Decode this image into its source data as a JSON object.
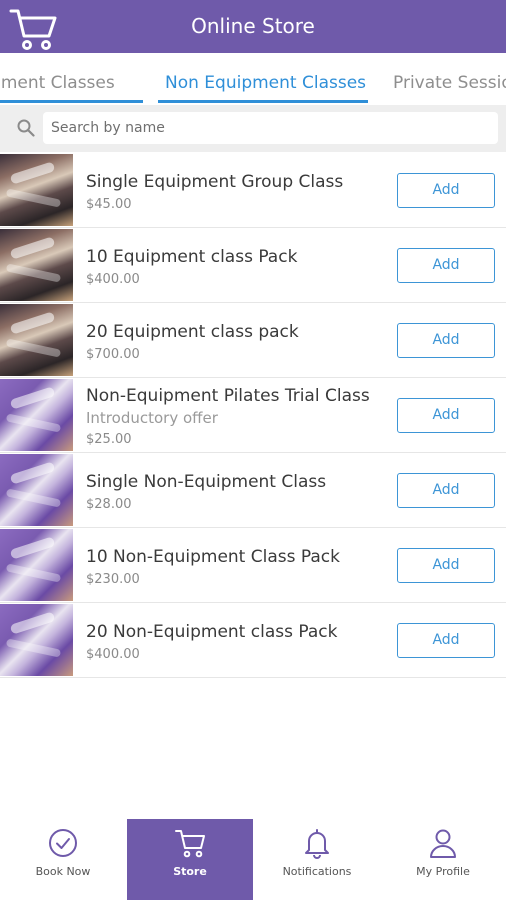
{
  "header": {
    "title": "Online Store",
    "cart_icon": "cart-icon"
  },
  "tabs": [
    {
      "label": "Equipment Classes",
      "active": false
    },
    {
      "label": "Non Equipment Classes",
      "active": true
    },
    {
      "label": "Private Sessions",
      "active": false
    }
  ],
  "search": {
    "placeholder": "Search by name",
    "icon": "search-icon"
  },
  "products": [
    {
      "name": "Single Equipment Group Class",
      "subtitle": "",
      "price": "$45.00",
      "thumb": "equipment",
      "button": "Add"
    },
    {
      "name": "10 Equipment class Pack",
      "subtitle": "",
      "price": "$400.00",
      "thumb": "equipment",
      "button": "Add"
    },
    {
      "name": "20 Equipment class pack",
      "subtitle": "",
      "price": "$700.00",
      "thumb": "equipment",
      "button": "Add"
    },
    {
      "name": "Non-Equipment Pilates Trial Class",
      "subtitle": "Introductory offer",
      "price": "$25.00",
      "thumb": "non-equipment",
      "button": "Add"
    },
    {
      "name": "Single Non-Equipment Class",
      "subtitle": "",
      "price": "$28.00",
      "thumb": "non-equipment",
      "button": "Add"
    },
    {
      "name": "10 Non-Equipment Class Pack",
      "subtitle": "",
      "price": "$230.00",
      "thumb": "non-equipment",
      "button": "Add"
    },
    {
      "name": "20 Non-Equipment class Pack",
      "subtitle": "",
      "price": "$400.00",
      "thumb": "non-equipment",
      "button": "Add"
    }
  ],
  "bottom_nav": [
    {
      "label": "Book Now",
      "icon": "check-circle-icon",
      "active": false
    },
    {
      "label": "Store",
      "icon": "cart-icon",
      "active": true
    },
    {
      "label": "Notifications",
      "icon": "bell-icon",
      "active": false
    },
    {
      "label": "My Profile",
      "icon": "person-icon",
      "active": false
    }
  ],
  "colors": {
    "brand": "#6f5aaa",
    "accent": "#2f8fd8"
  }
}
